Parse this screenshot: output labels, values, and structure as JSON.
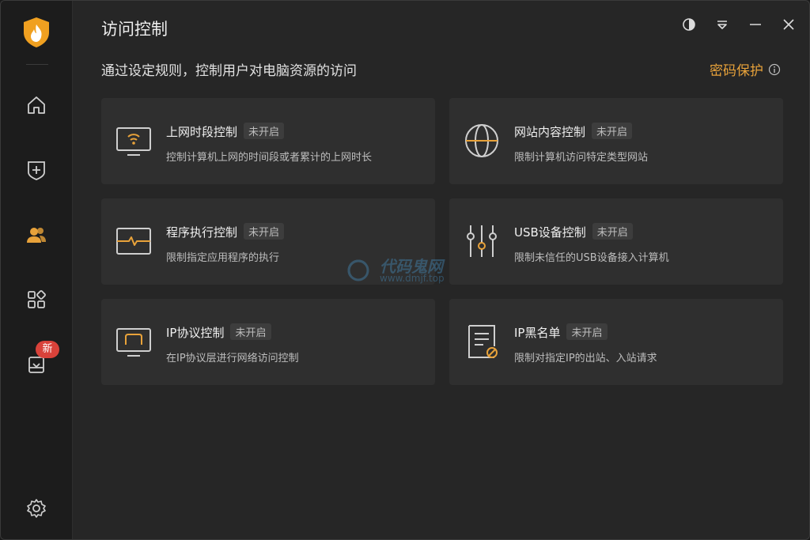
{
  "window": {
    "title": "访问控制"
  },
  "sidebar": {
    "items": [
      {
        "name": "home",
        "icon": "home-icon"
      },
      {
        "name": "protect",
        "icon": "shield-plus-icon"
      },
      {
        "name": "access-control",
        "icon": "users-icon",
        "active": true
      },
      {
        "name": "apps",
        "icon": "apps-grid-icon"
      },
      {
        "name": "new-feature",
        "icon": "box-icon",
        "badge": "新"
      }
    ],
    "settings_icon": "gear-icon"
  },
  "header": {
    "subtitle": "通过设定规则，控制用户对电脑资源的访问",
    "password_protect": "密码保护"
  },
  "cards": [
    {
      "title": "上网时段控制",
      "status": "未开启",
      "desc": "控制计算机上网的时间段或者累计的上网时长",
      "icon": "monitor-wifi-icon"
    },
    {
      "title": "网站内容控制",
      "status": "未开启",
      "desc": "限制计算机访问特定类型网站",
      "icon": "globe-icon"
    },
    {
      "title": "程序执行控制",
      "status": "未开启",
      "desc": "限制指定应用程序的执行",
      "icon": "pulse-window-icon"
    },
    {
      "title": "USB设备控制",
      "status": "未开启",
      "desc": "限制未信任的USB设备接入计算机",
      "icon": "sliders-icon"
    },
    {
      "title": "IP协议控制",
      "status": "未开启",
      "desc": "在IP协议层进行网络访问控制",
      "icon": "monitor-screen-icon"
    },
    {
      "title": "IP黑名单",
      "status": "未开启",
      "desc": "限制对指定IP的出站、入站请求",
      "icon": "blocklist-doc-icon"
    }
  ],
  "watermark": {
    "text": "代码鬼网",
    "sub": "www.dmjf.top"
  },
  "colors": {
    "accent": "#e8a23a",
    "bg": "#262626",
    "card": "#2f2f2f",
    "badge": "#d9423a"
  }
}
